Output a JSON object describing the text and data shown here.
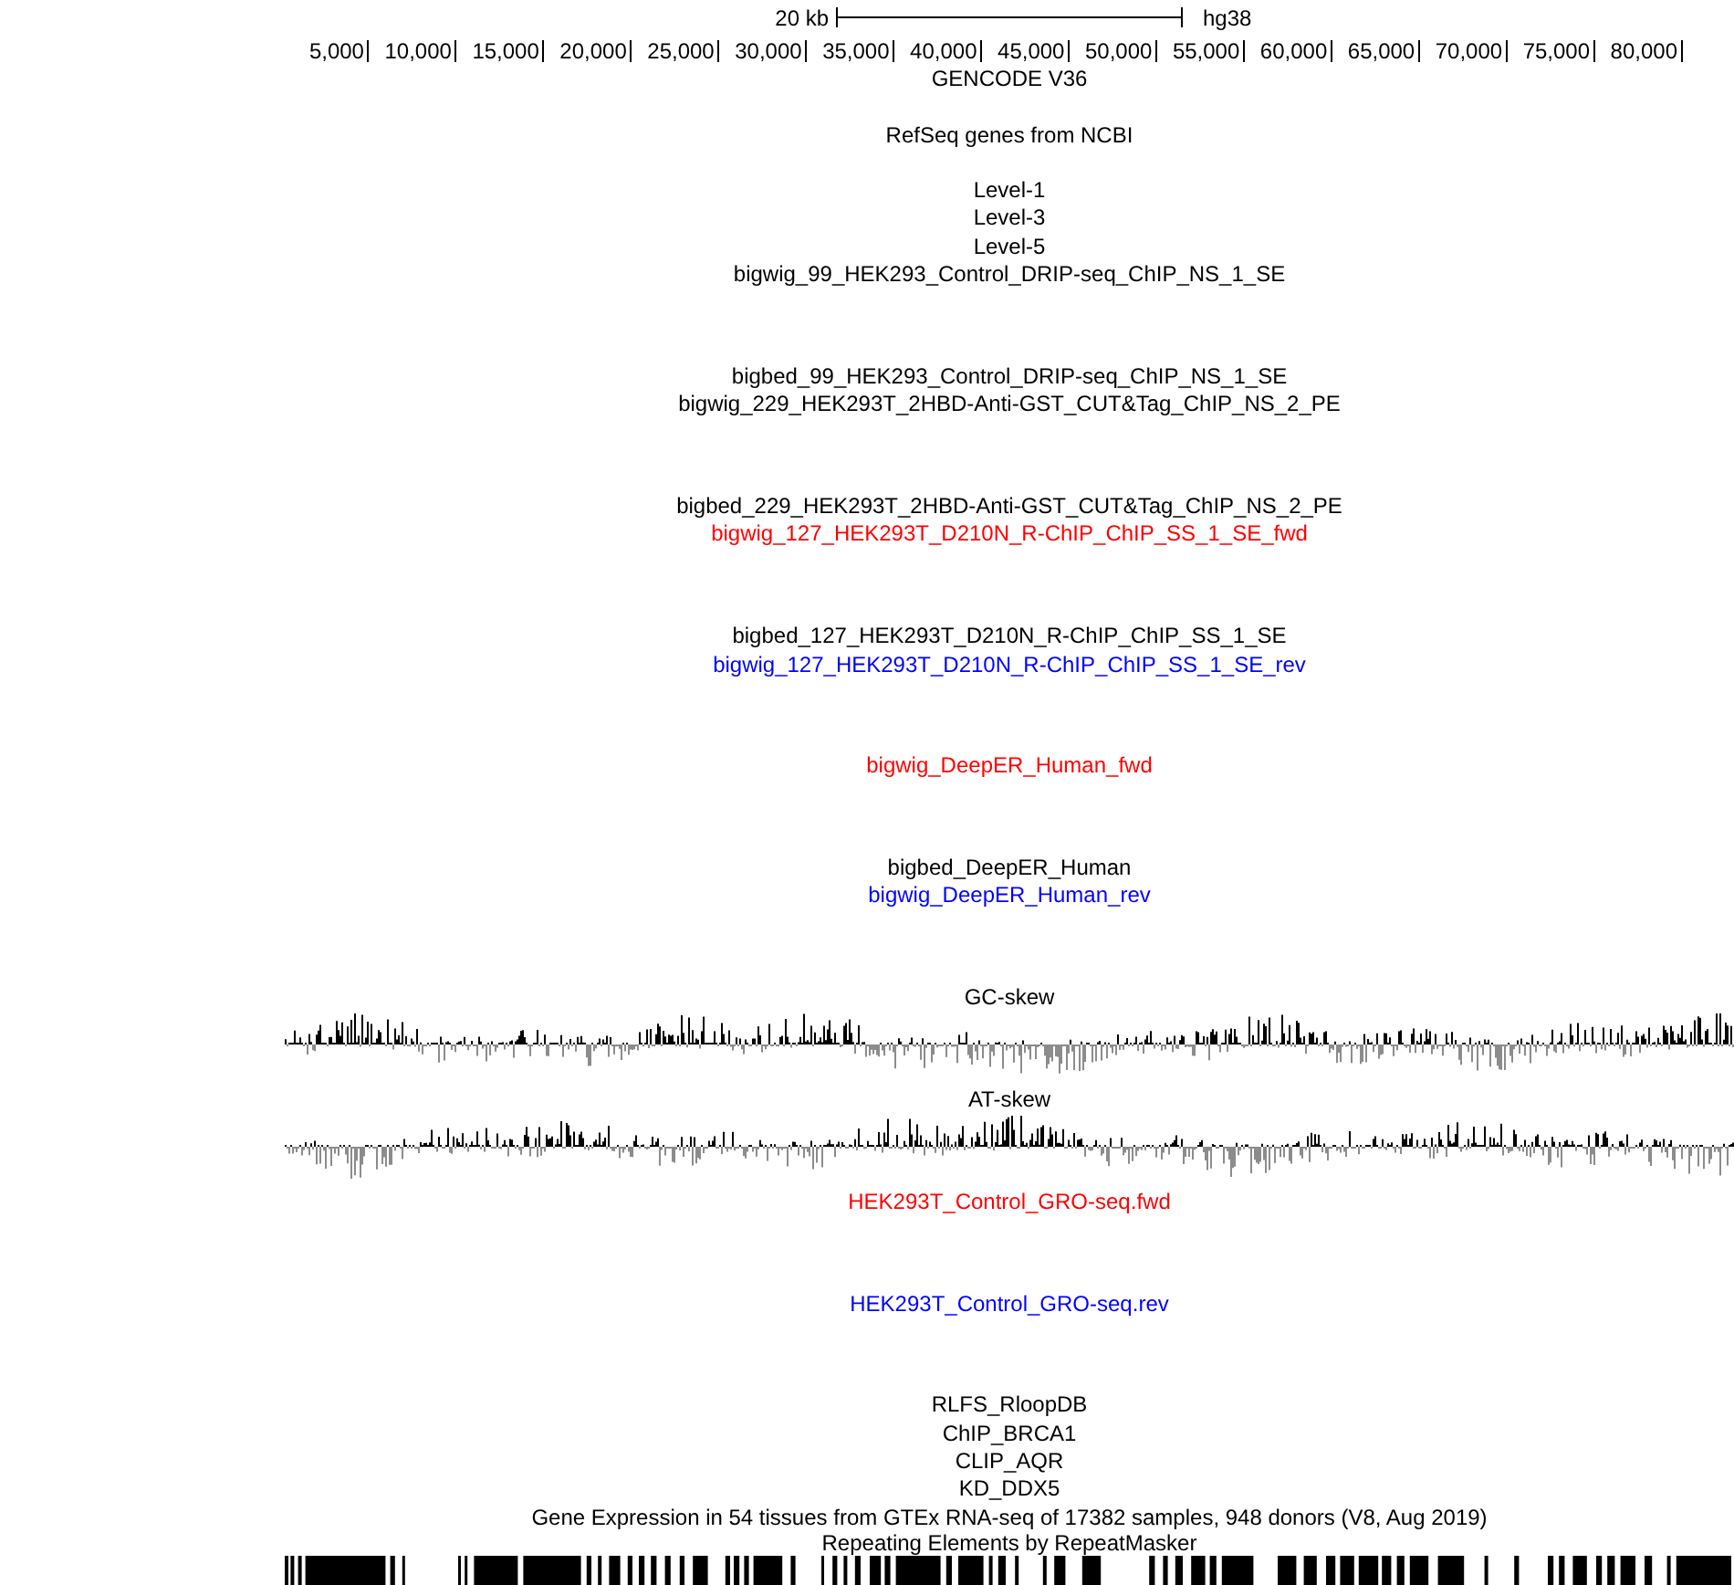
{
  "scale_bar": {
    "length_label": "20 kb",
    "assembly": "hg38"
  },
  "ruler": {
    "ticks": [
      "5,000",
      "10,000",
      "15,000",
      "20,000",
      "25,000",
      "30,000",
      "35,000",
      "40,000",
      "45,000",
      "50,000",
      "55,000",
      "60,000",
      "65,000",
      "70,000",
      "75,000",
      "80,000"
    ]
  },
  "tracks": [
    {
      "kind": "label",
      "label": "GENCODE V36",
      "color": "#000000"
    },
    {
      "kind": "label",
      "label": "RefSeq genes from NCBI",
      "color": "#000000"
    },
    {
      "kind": "label",
      "label": "Level-1",
      "color": "#000000"
    },
    {
      "kind": "label",
      "label": "Level-3",
      "color": "#000000"
    },
    {
      "kind": "label",
      "label": "Level-5",
      "color": "#000000"
    },
    {
      "kind": "label",
      "label": "bigwig_99_HEK293_Control_DRIP-seq_ChIP_NS_1_SE",
      "color": "#000000"
    },
    {
      "kind": "label",
      "label": "bigbed_99_HEK293_Control_DRIP-seq_ChIP_NS_1_SE",
      "color": "#000000"
    },
    {
      "kind": "label",
      "label": "bigwig_229_HEK293T_2HBD-Anti-GST_CUT&Tag_ChIP_NS_2_PE",
      "color": "#000000"
    },
    {
      "kind": "label",
      "label": "bigbed_229_HEK293T_2HBD-Anti-GST_CUT&Tag_ChIP_NS_2_PE",
      "color": "#000000"
    },
    {
      "kind": "label",
      "label": "bigwig_127_HEK293T_D210N_R-ChIP_ChIP_SS_1_SE_fwd",
      "color": "#ff0000"
    },
    {
      "kind": "label",
      "label": "bigbed_127_HEK293T_D210N_R-ChIP_ChIP_SS_1_SE",
      "color": "#000000"
    },
    {
      "kind": "label",
      "label": "bigwig_127_HEK293T_D210N_R-ChIP_ChIP_SS_1_SE_rev",
      "color": "#0000ff"
    },
    {
      "kind": "label",
      "label": "bigwig_DeepER_Human_fwd",
      "color": "#ff0000"
    },
    {
      "kind": "label",
      "label": "bigbed_DeepER_Human",
      "color": "#000000"
    },
    {
      "kind": "label",
      "label": "bigwig_DeepER_Human_rev",
      "color": "#0000ff"
    },
    {
      "kind": "wiggle",
      "label": "GC-skew",
      "color": "#000000"
    },
    {
      "kind": "wiggle",
      "label": "AT-skew",
      "color": "#000000"
    },
    {
      "kind": "label",
      "label": "HEK293T_Control_GRO-seq.fwd",
      "color": "#ff0000"
    },
    {
      "kind": "label",
      "label": "HEK293T_Control_GRO-seq.rev",
      "color": "#0000ff"
    },
    {
      "kind": "label",
      "label": "RLFS_RloopDB",
      "color": "#000000"
    },
    {
      "kind": "label",
      "label": "ChIP_BRCA1",
      "color": "#000000"
    },
    {
      "kind": "label",
      "label": "CLIP_AQR",
      "color": "#000000"
    },
    {
      "kind": "label",
      "label": "KD_DDX5",
      "color": "#000000"
    },
    {
      "kind": "label",
      "label": "Gene Expression in 54 tissues from GTEx RNA-seq of 17382 samples, 948 donors (V8, Aug 2019)",
      "color": "#000000"
    },
    {
      "kind": "dense",
      "label": "Repeating Elements by RepeatMasker",
      "color": "#000000"
    }
  ]
}
